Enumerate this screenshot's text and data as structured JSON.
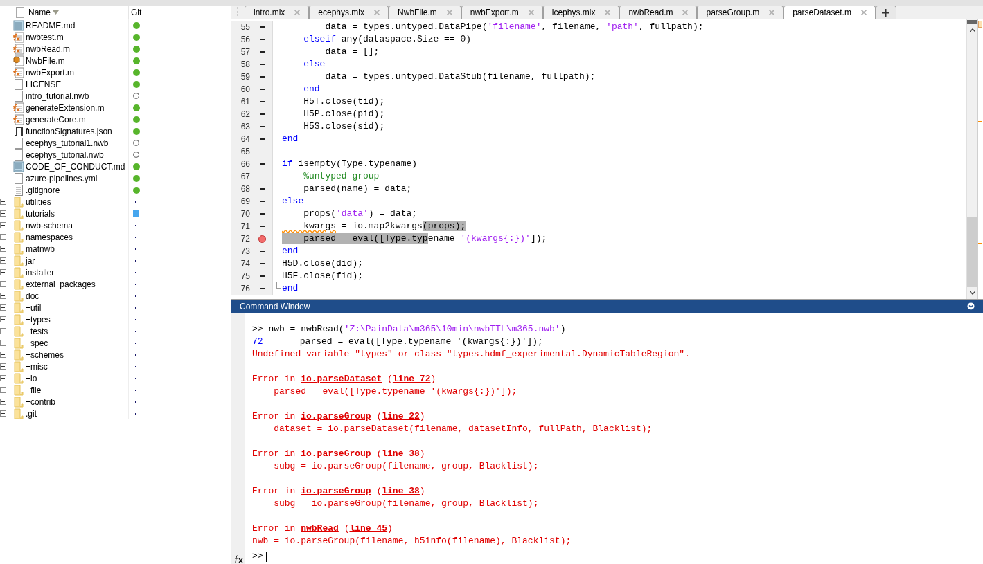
{
  "folder_panel": {
    "columns": [
      {
        "label": "Name",
        "sorted": true
      },
      {
        "label": "Git",
        "sorted": false
      }
    ],
    "files": [
      {
        "name": "README.md",
        "kind": "text-doc",
        "git": {
          "kind": "tracked"
        }
      },
      {
        "name": "nwbtest.m",
        "kind": "function",
        "git": {
          "kind": "tracked"
        }
      },
      {
        "name": "nwbRead.m",
        "kind": "function",
        "git": {
          "kind": "tracked"
        }
      },
      {
        "name": "NwbFile.m",
        "kind": "class",
        "git": {
          "kind": "tracked"
        }
      },
      {
        "name": "nwbExport.m",
        "kind": "function",
        "git": {
          "kind": "tracked"
        }
      },
      {
        "name": "LICENSE",
        "kind": "blank",
        "git": {
          "kind": "tracked"
        }
      },
      {
        "name": "intro_tutorial.nwb",
        "kind": "blank",
        "git": {
          "kind": "untracked"
        }
      },
      {
        "name": "generateExtension.m",
        "kind": "function",
        "git": {
          "kind": "tracked"
        }
      },
      {
        "name": "generateCore.m",
        "kind": "function",
        "git": {
          "kind": "tracked"
        }
      },
      {
        "name": "functionSignatures.json",
        "kind": "json",
        "git": {
          "kind": "tracked"
        }
      },
      {
        "name": "ecephys_tutorial1.nwb",
        "kind": "blank",
        "git": {
          "kind": "untracked"
        }
      },
      {
        "name": "ecephys_tutorial.nwb",
        "kind": "blank",
        "git": {
          "kind": "untracked"
        }
      },
      {
        "name": "CODE_OF_CONDUCT.md",
        "kind": "text-doc",
        "git": {
          "kind": "tracked"
        }
      },
      {
        "name": "azure-pipelines.yml",
        "kind": "blank",
        "git": {
          "kind": "tracked"
        }
      },
      {
        "name": ".gitignore",
        "kind": "lined",
        "git": {
          "kind": "tracked"
        }
      },
      {
        "name": "utilities",
        "kind": "folder",
        "git": {
          "kind": "none"
        }
      },
      {
        "name": "tutorials",
        "kind": "folder",
        "git": {
          "kind": "modified"
        }
      },
      {
        "name": "nwb-schema",
        "kind": "folder",
        "git": {
          "kind": "none"
        }
      },
      {
        "name": "namespaces",
        "kind": "folder",
        "git": {
          "kind": "none"
        }
      },
      {
        "name": "matnwb",
        "kind": "folder",
        "git": {
          "kind": "none"
        }
      },
      {
        "name": "jar",
        "kind": "folder",
        "git": {
          "kind": "none"
        }
      },
      {
        "name": "installer",
        "kind": "folder",
        "git": {
          "kind": "none"
        }
      },
      {
        "name": "external_packages",
        "kind": "folder",
        "git": {
          "kind": "none"
        }
      },
      {
        "name": "doc",
        "kind": "folder",
        "git": {
          "kind": "none"
        }
      },
      {
        "name": "+util",
        "kind": "folder",
        "git": {
          "kind": "none"
        }
      },
      {
        "name": "+types",
        "kind": "folder",
        "git": {
          "kind": "none"
        }
      },
      {
        "name": "+tests",
        "kind": "folder",
        "git": {
          "kind": "none"
        }
      },
      {
        "name": "+spec",
        "kind": "folder",
        "git": {
          "kind": "none"
        }
      },
      {
        "name": "+schemes",
        "kind": "folder",
        "git": {
          "kind": "none"
        }
      },
      {
        "name": "+misc",
        "kind": "folder",
        "git": {
          "kind": "none"
        }
      },
      {
        "name": "+io",
        "kind": "folder",
        "git": {
          "kind": "none"
        }
      },
      {
        "name": "+file",
        "kind": "folder",
        "git": {
          "kind": "none"
        }
      },
      {
        "name": "+contrib",
        "kind": "folder",
        "git": {
          "kind": "none"
        }
      },
      {
        "name": ".git",
        "kind": "folder",
        "git": {
          "kind": "none"
        }
      }
    ]
  },
  "editor": {
    "tabs": [
      {
        "label": "intro.mlx",
        "selected": false
      },
      {
        "label": "ecephys.mlx",
        "selected": false
      },
      {
        "label": "NwbFile.m",
        "selected": false
      },
      {
        "label": "nwbExport.m",
        "selected": false
      },
      {
        "label": "icephys.mlx",
        "selected": false
      },
      {
        "label": "nwbRead.m",
        "selected": false
      },
      {
        "label": "parseGroup.m",
        "selected": false
      },
      {
        "label": "parseDataset.m",
        "selected": true
      }
    ],
    "lines": [
      {
        "number": "55",
        "executable": true,
        "breakpoint": false,
        "tokens": [
          {
            "text": "        data = types.untyped.DataPipe(",
            "kind": "plain",
            "selected": false
          },
          {
            "text": "'filename'",
            "kind": "string",
            "selected": false
          },
          {
            "text": ", filename, ",
            "kind": "plain",
            "selected": false
          },
          {
            "text": "'path'",
            "kind": "string",
            "selected": false
          },
          {
            "text": ", fullpath);",
            "kind": "plain",
            "selected": false
          }
        ]
      },
      {
        "number": "56",
        "executable": true,
        "breakpoint": false,
        "tokens": [
          {
            "text": "    elseif",
            "kind": "keyword",
            "selected": false
          },
          {
            "text": " any(dataspace.Size == 0)",
            "kind": "plain",
            "selected": false
          }
        ]
      },
      {
        "number": "57",
        "executable": true,
        "breakpoint": false,
        "tokens": [
          {
            "text": "        data = [];",
            "kind": "plain",
            "selected": false
          }
        ]
      },
      {
        "number": "58",
        "executable": true,
        "breakpoint": false,
        "tokens": [
          {
            "text": "    else",
            "kind": "keyword",
            "selected": false
          }
        ]
      },
      {
        "number": "59",
        "executable": true,
        "breakpoint": false,
        "tokens": [
          {
            "text": "        data = types.untyped.DataStub(filename, fullpath);",
            "kind": "plain",
            "selected": false
          }
        ]
      },
      {
        "number": "60",
        "executable": true,
        "breakpoint": false,
        "tokens": [
          {
            "text": "    end",
            "kind": "keyword",
            "selected": false
          }
        ]
      },
      {
        "number": "61",
        "executable": true,
        "breakpoint": false,
        "tokens": [
          {
            "text": "    H5T.close(tid);",
            "kind": "plain",
            "selected": false
          }
        ]
      },
      {
        "number": "62",
        "executable": true,
        "breakpoint": false,
        "tokens": [
          {
            "text": "    H5P.close(pid);",
            "kind": "plain",
            "selected": false
          }
        ]
      },
      {
        "number": "63",
        "executable": true,
        "breakpoint": false,
        "tokens": [
          {
            "text": "    H5S.close(sid);",
            "kind": "plain",
            "selected": false
          }
        ]
      },
      {
        "number": "64",
        "executable": true,
        "breakpoint": false,
        "tokens": [
          {
            "text": "end",
            "kind": "keyword",
            "selected": false
          }
        ]
      },
      {
        "number": "65",
        "executable": false,
        "breakpoint": false
      },
      {
        "number": "66",
        "executable": true,
        "breakpoint": false,
        "tokens": [
          {
            "text": "if",
            "kind": "keyword",
            "selected": false
          },
          {
            "text": " isempty(Type.typename)",
            "kind": "plain",
            "selected": false
          }
        ]
      },
      {
        "number": "67",
        "executable": false,
        "breakpoint": false,
        "tokens": [
          {
            "text": "    %untyped group",
            "kind": "comment",
            "selected": false
          }
        ]
      },
      {
        "number": "68",
        "executable": true,
        "breakpoint": false,
        "tokens": [
          {
            "text": "    parsed(name) = data;",
            "kind": "plain",
            "selected": false
          }
        ]
      },
      {
        "number": "69",
        "executable": true,
        "breakpoint": false,
        "tokens": [
          {
            "text": "else",
            "kind": "keyword",
            "selected": false
          }
        ]
      },
      {
        "number": "70",
        "executable": true,
        "breakpoint": false,
        "tokens": [
          {
            "text": "    props(",
            "kind": "plain",
            "selected": false
          },
          {
            "text": "'data'",
            "kind": "string",
            "selected": false
          },
          {
            "text": ") = data;",
            "kind": "plain",
            "selected": false
          }
        ]
      },
      {
        "number": "71",
        "executable": true,
        "breakpoint": false,
        "tokens": [
          {
            "text": "    kwargs",
            "kind": "warning",
            "selected": false
          },
          {
            "text": " = io.map2kwargs",
            "kind": "plain",
            "selected": false
          },
          {
            "text": "(props);",
            "kind": "plain",
            "selected": true
          }
        ]
      },
      {
        "number": "72",
        "executable": true,
        "breakpoint": true,
        "tokens": [
          {
            "text": "    parsed = eval([Type.typ",
            "kind": "plain",
            "selected": true
          },
          {
            "text": "ename ",
            "kind": "plain",
            "selected": false
          },
          {
            "text": "'(kwargs{:})'",
            "kind": "string",
            "selected": false
          },
          {
            "text": "]);",
            "kind": "plain",
            "selected": false
          }
        ]
      },
      {
        "number": "73",
        "executable": true,
        "breakpoint": false,
        "tokens": [
          {
            "text": "end",
            "kind": "keyword",
            "selected": false
          }
        ]
      },
      {
        "number": "74",
        "executable": true,
        "breakpoint": false,
        "tokens": [
          {
            "text": "H5D.close(did);",
            "kind": "plain",
            "selected": false
          }
        ]
      },
      {
        "number": "75",
        "executable": true,
        "breakpoint": false,
        "tokens": [
          {
            "text": "H5F.close(fid);",
            "kind": "plain",
            "selected": false
          }
        ]
      },
      {
        "number": "76",
        "executable": true,
        "breakpoint": false,
        "tokens": [
          {
            "text": "end",
            "kind": "keyword",
            "selected": false
          }
        ]
      }
    ]
  },
  "command_window": {
    "title": "Command Window",
    "lines": [
      {
        "kind": "text",
        "segments": [
          {
            "text": ">> nwb = nwbRead(",
            "kind": "plain"
          },
          {
            "text": "'Z:\\PainData\\m365\\10min\\nwbTTL\\m365.nwb'",
            "kind": "string"
          },
          {
            "text": ")",
            "kind": "plain"
          }
        ]
      },
      {
        "kind": "text",
        "segments": [
          {
            "text": "72",
            "kind": "link"
          },
          {
            "text": "    parsed = eval([Type.typename '(kwargs{:})']);",
            "kind": "plain"
          }
        ]
      },
      {
        "kind": "text",
        "segments": [
          {
            "text": "Undefined variable \"types\" or class \"types.hdmf_experimental.DynamicTableRegion\".",
            "kind": "error"
          }
        ]
      },
      {
        "kind": "blank"
      },
      {
        "kind": "text",
        "segments": [
          {
            "text": "Error in ",
            "kind": "error"
          },
          {
            "text": "io.parseDataset",
            "kind": "error-link"
          },
          {
            "text": " (",
            "kind": "error"
          },
          {
            "text": "line 72",
            "kind": "error-link"
          },
          {
            "text": ")",
            "kind": "error"
          }
        ]
      },
      {
        "kind": "text",
        "segments": [
          {
            "text": "    parsed = eval([Type.typename '(kwargs{:})']);",
            "kind": "error"
          }
        ]
      },
      {
        "kind": "blank"
      },
      {
        "kind": "text",
        "segments": [
          {
            "text": "Error in ",
            "kind": "error"
          },
          {
            "text": "io.parseGroup",
            "kind": "error-link"
          },
          {
            "text": " (",
            "kind": "error"
          },
          {
            "text": "line 22",
            "kind": "error-link"
          },
          {
            "text": ")",
            "kind": "error"
          }
        ]
      },
      {
        "kind": "text",
        "segments": [
          {
            "text": "    dataset = io.parseDataset(filename, datasetInfo, fullPath, Blacklist);",
            "kind": "error"
          }
        ]
      },
      {
        "kind": "blank"
      },
      {
        "kind": "text",
        "segments": [
          {
            "text": "Error in ",
            "kind": "error"
          },
          {
            "text": "io.parseGroup",
            "kind": "error-link"
          },
          {
            "text": " (",
            "kind": "error"
          },
          {
            "text": "line 38",
            "kind": "error-link"
          },
          {
            "text": ")",
            "kind": "error"
          }
        ]
      },
      {
        "kind": "text",
        "segments": [
          {
            "text": "    subg = io.parseGroup(filename, group, Blacklist);",
            "kind": "error"
          }
        ]
      },
      {
        "kind": "blank"
      },
      {
        "kind": "text",
        "segments": [
          {
            "text": "Error in ",
            "kind": "error"
          },
          {
            "text": "io.parseGroup",
            "kind": "error-link"
          },
          {
            "text": " (",
            "kind": "error"
          },
          {
            "text": "line 38",
            "kind": "error-link"
          },
          {
            "text": ")",
            "kind": "error"
          }
        ]
      },
      {
        "kind": "text",
        "segments": [
          {
            "text": "    subg = io.parseGroup(filename, group, Blacklist);",
            "kind": "error"
          }
        ]
      },
      {
        "kind": "blank"
      },
      {
        "kind": "text",
        "segments": [
          {
            "text": "Error in ",
            "kind": "error"
          },
          {
            "text": "nwbRead",
            "kind": "error-link"
          },
          {
            "text": " (",
            "kind": "error"
          },
          {
            "text": "line 45",
            "kind": "error-link"
          },
          {
            "text": ")",
            "kind": "error"
          }
        ]
      },
      {
        "kind": "text",
        "segments": [
          {
            "text": "nwb = io.parseGroup(filename, h5info(filename), Blacklist);",
            "kind": "error"
          }
        ]
      }
    ],
    "prompt": ">>"
  }
}
